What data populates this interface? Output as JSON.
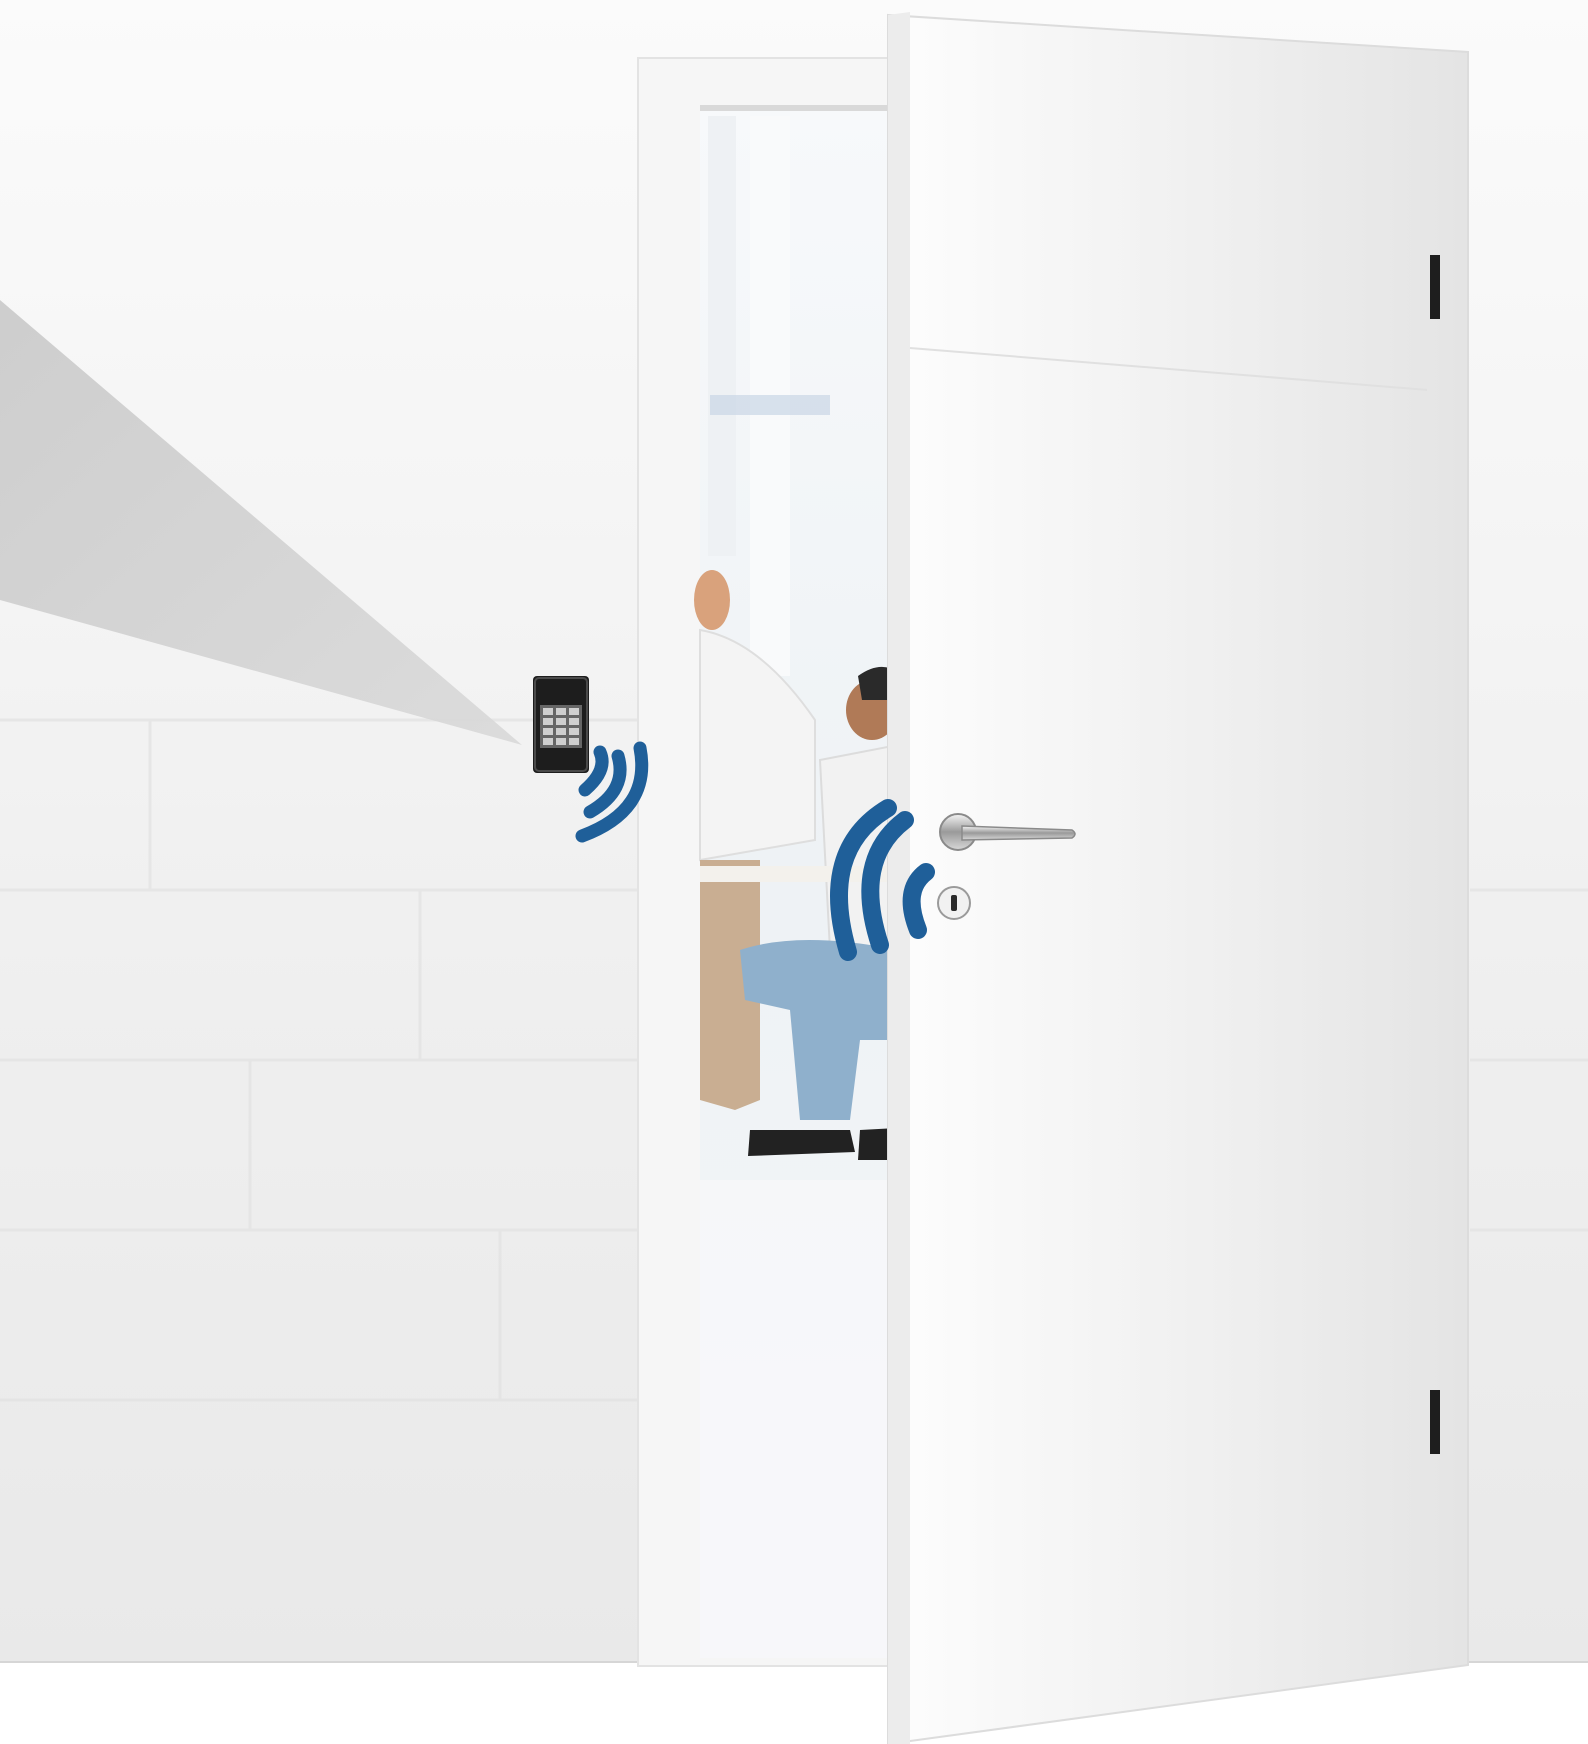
{
  "scene": {
    "description_colors": {
      "wall": "#f2f2f2",
      "wall_mortar": "#e6e6e6",
      "floor": "#ffffff",
      "door": "#f4f4f4",
      "frame": "#f7f7f7",
      "signal_blue": "#1f5f99",
      "keypad_body": "#1d1d1d",
      "callout_gray": "#cfcfcf"
    },
    "icons": [
      "keypad-reader-icon",
      "wireless-signal-icon",
      "door-lock-signal-icon",
      "door-handle-icon",
      "keyhole-icon"
    ]
  }
}
